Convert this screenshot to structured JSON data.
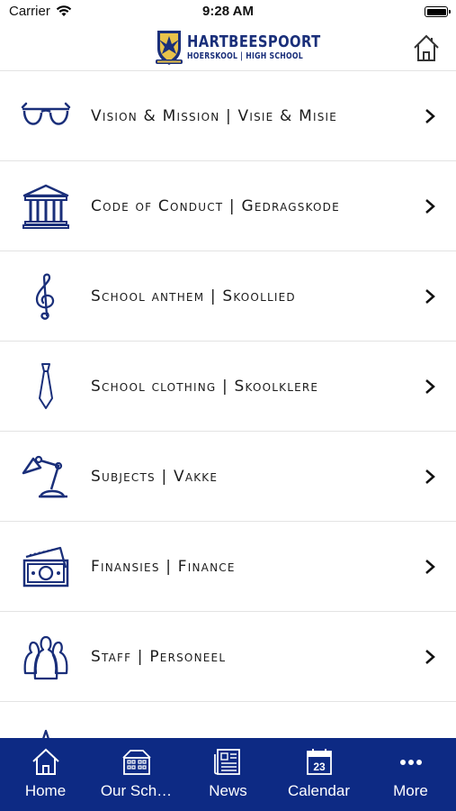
{
  "status_bar": {
    "carrier": "Carrier",
    "time": "9:28 AM"
  },
  "header": {
    "logo_title": "HARTBEESPOORT",
    "logo_subtitle": "HOËRSKOOL | HIGH SCHOOL",
    "home_icon": "home-icon"
  },
  "menu": {
    "items": [
      {
        "label": "Vision & Mission | Visie & Misie",
        "icon": "glasses-icon"
      },
      {
        "label": "Code of Conduct | Gedragskode",
        "icon": "building-columns-icon"
      },
      {
        "label": "School anthem | Skoollied",
        "icon": "treble-clef-icon"
      },
      {
        "label": "School clothing | Skoolklere",
        "icon": "tie-icon"
      },
      {
        "label": "Subjects | Vakke",
        "icon": "desk-lamp-icon"
      },
      {
        "label": "Finansies | Finance",
        "icon": "money-icon"
      },
      {
        "label": "Staff | Personeel",
        "icon": "people-icon"
      }
    ]
  },
  "tabbar": {
    "accent": "#0d2a84",
    "tabs": [
      {
        "label": "Home",
        "icon": "home-icon"
      },
      {
        "label": "Our Sch…",
        "icon": "school-building-icon"
      },
      {
        "label": "News",
        "icon": "newspaper-icon"
      },
      {
        "label": "Calendar",
        "icon": "calendar-icon",
        "day": "23"
      },
      {
        "label": "More",
        "icon": "more-dots-icon"
      }
    ]
  }
}
